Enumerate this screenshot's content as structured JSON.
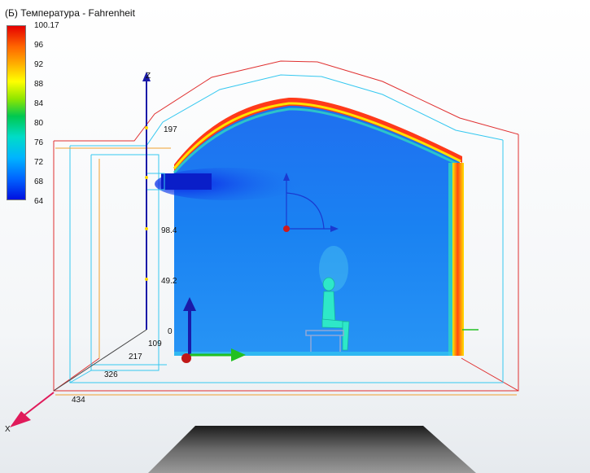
{
  "title": "(Б) Температура - Fahrenheit",
  "legend": {
    "labels": [
      "100.17",
      "96",
      "92",
      "88",
      "84",
      "80",
      "76",
      "72",
      "68",
      "64"
    ]
  },
  "z_axis": {
    "label": "Z",
    "ticks": [
      "197",
      "98.4",
      "49.2",
      "0"
    ]
  },
  "x_axis": {
    "label": "X",
    "ticks": [
      "109",
      "217",
      "326",
      "434"
    ]
  },
  "colors": {
    "cold": "#0a3cff",
    "room_fill": "#1e7cf0",
    "hot_wall": "#ff3a1a",
    "frame_red": "#e03030",
    "frame_cyan": "#35c8f0",
    "frame_orange": "#f0a030",
    "axis_blue": "#1a1aa8",
    "axis_green": "#22c022",
    "axis_pink": "#e01a5a"
  },
  "icons": [
    "vent-inlet-icon",
    "seated-person-icon",
    "chair-icon",
    "origin-triad-icon",
    "rotation-gizmo-icon",
    "pedestal-icon"
  ]
}
